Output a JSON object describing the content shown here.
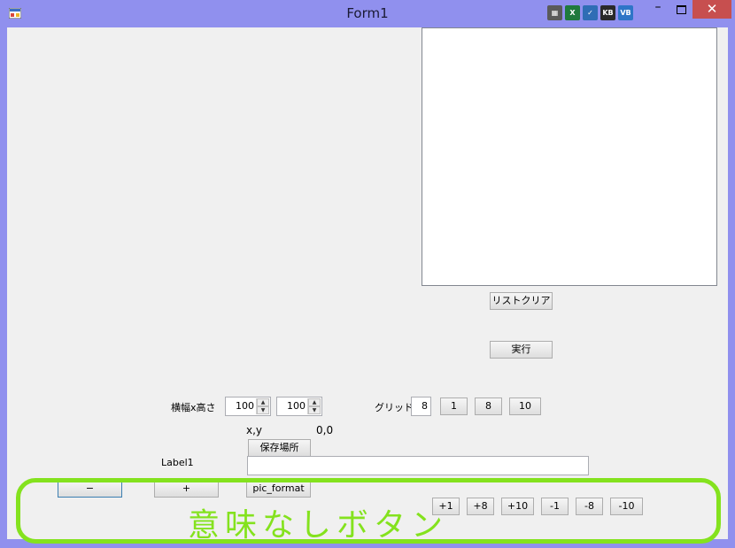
{
  "window": {
    "title": "Form1",
    "close_glyph": "✕",
    "minimize_glyph": "–",
    "tray_icons": [
      "calendar-icon",
      "excel-icon",
      "outlook-icon",
      "kb-icon",
      "vb-icon"
    ]
  },
  "buttons": {
    "list_clear": "リストクリア",
    "run": "実行",
    "save_location": "保存場所",
    "pic_format": "pic_format",
    "minus": "−",
    "plus": "+",
    "grid_1": "1",
    "grid_8": "8",
    "grid_10": "10",
    "step": [
      "+1",
      "+8",
      "+10",
      "-1",
      "-8",
      "-10"
    ]
  },
  "labels": {
    "size": "横幅x高さ",
    "grid": "グリッド",
    "xy": "x,y",
    "xy_value": "0,0",
    "label1": "Label1"
  },
  "inputs": {
    "width_value": "100",
    "height_value": "100",
    "grid_value": "8",
    "save_path_value": ""
  },
  "annotation": {
    "text": "意味なしボタン",
    "color": "#84e21e"
  },
  "colors": {
    "title_bar": "#9090ee",
    "close_button": "#c74f4f",
    "form_background": "#f0f0f0"
  }
}
